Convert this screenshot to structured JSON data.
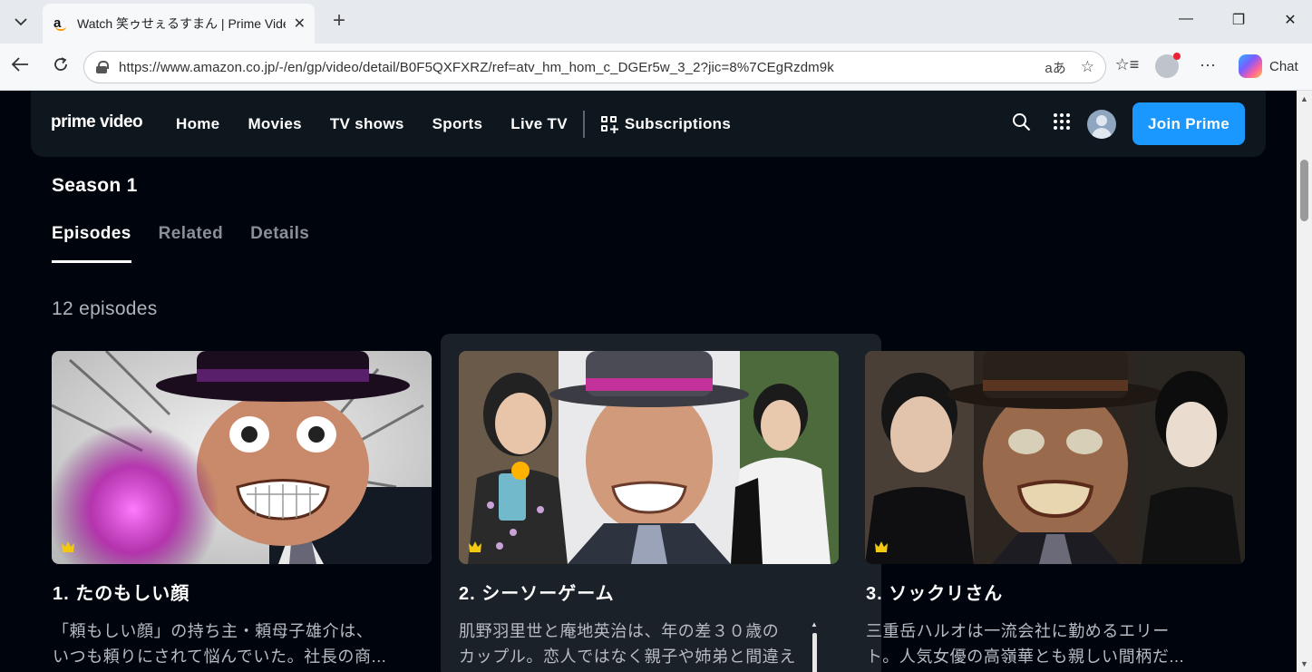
{
  "browser": {
    "tab_title": "Watch 笑ゥせぇるすまん | Prime Video",
    "tab_favicon": "a",
    "url": "https://www.amazon.co.jp/-/en/gp/video/detail/B0F5QXFXRZ/ref=atv_hm_hom_c_DGEr5w_3_2?jic=8%7CEgRzdm9k",
    "copilot_label": "Chat",
    "icons": [
      "tab-list-icon",
      "close-icon",
      "new-tab-icon",
      "minimize-icon",
      "restore-icon",
      "close-window-icon",
      "back-icon",
      "reload-icon",
      "translate-icon",
      "star-icon",
      "favorites-icon",
      "more-icon"
    ]
  },
  "header": {
    "logo": "prime video",
    "nav": [
      "Home",
      "Movies",
      "TV shows",
      "Sports",
      "Live TV"
    ],
    "subscriptions": "Subscriptions",
    "join_button": "Join Prime",
    "accent_color": "#1a98ff"
  },
  "main": {
    "season": "Season 1",
    "tabs": [
      "Episodes",
      "Related",
      "Details"
    ],
    "active_tab": "Episodes",
    "episode_count": "12 episodes",
    "episodes": [
      {
        "title": "1. たのもしい顔",
        "desc_line1": "「頼もしい顔」の持ち主・頼母子雄介は、",
        "desc_line2": "いつも頼りにされて悩んでいた。社長の商..."
      },
      {
        "title": "2. シーソーゲーム",
        "desc_line1": "肌野羽里世と庵地英治は、年の差３０歳の",
        "desc_line2": "カップル。恋人ではなく親子や姉弟と間違え"
      },
      {
        "title": "3. ソックリさん",
        "desc_line1": "三重岳ハルオは一流会社に勤めるエリー",
        "desc_line2": "ト。人気女優の高嶺華とも親しい間柄だ..."
      }
    ]
  }
}
